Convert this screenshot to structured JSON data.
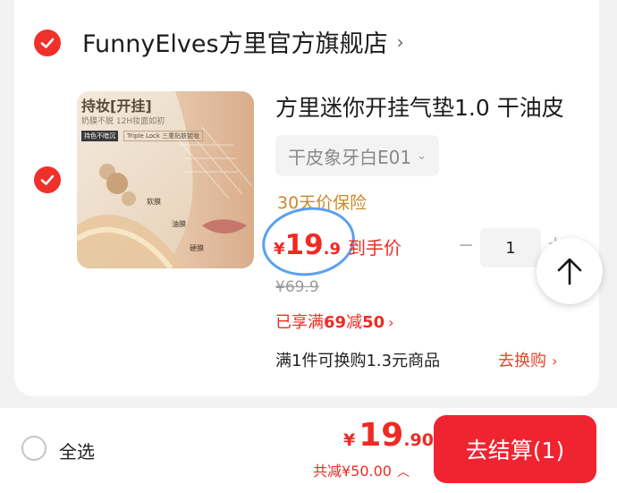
{
  "store": {
    "name": "FunnyElves方里官方旗舰店",
    "chevron": "›"
  },
  "product": {
    "image": {
      "tag": "持妆[开挂]",
      "subtitle": "奶膜不脱 12H妆面如初",
      "badge1": "持色不暗沉",
      "badge2": "Triple Lock 三重贴肤锁妆",
      "label1": "软膜",
      "label2": "油膜",
      "label3": "硬膜"
    },
    "title": "方里迷你开挂气垫1.0 干油皮",
    "sku": "干皮象牙白E01",
    "sku_chevron": "⌄",
    "price_protection": "30天价保险",
    "price": {
      "currency": "¥",
      "integer": "19",
      "decimal": ".9",
      "label": "到手价"
    },
    "original_price": "¥69.9",
    "promo": {
      "prefix": "已享满",
      "threshold": "69",
      "mid": "减",
      "amount": "50",
      "arrow": "›"
    },
    "exchange": {
      "text": "满1件可换购1.3元商品",
      "link": "去换购",
      "arrow": "›"
    },
    "quantity": {
      "minus": "−",
      "value": "1",
      "plus": "+"
    }
  },
  "footer": {
    "select_all": "全选",
    "total": {
      "currency": "¥",
      "integer": "19",
      "decimal": ".90"
    },
    "saving": "共减¥50.00",
    "saving_arrow": "︿",
    "checkout": "去结算(1)"
  },
  "colors": {
    "accent": "#ef2a24",
    "checkout_bg": "#ef2430",
    "protection": "#c98a2c",
    "annotation": "#5aa0ef"
  }
}
